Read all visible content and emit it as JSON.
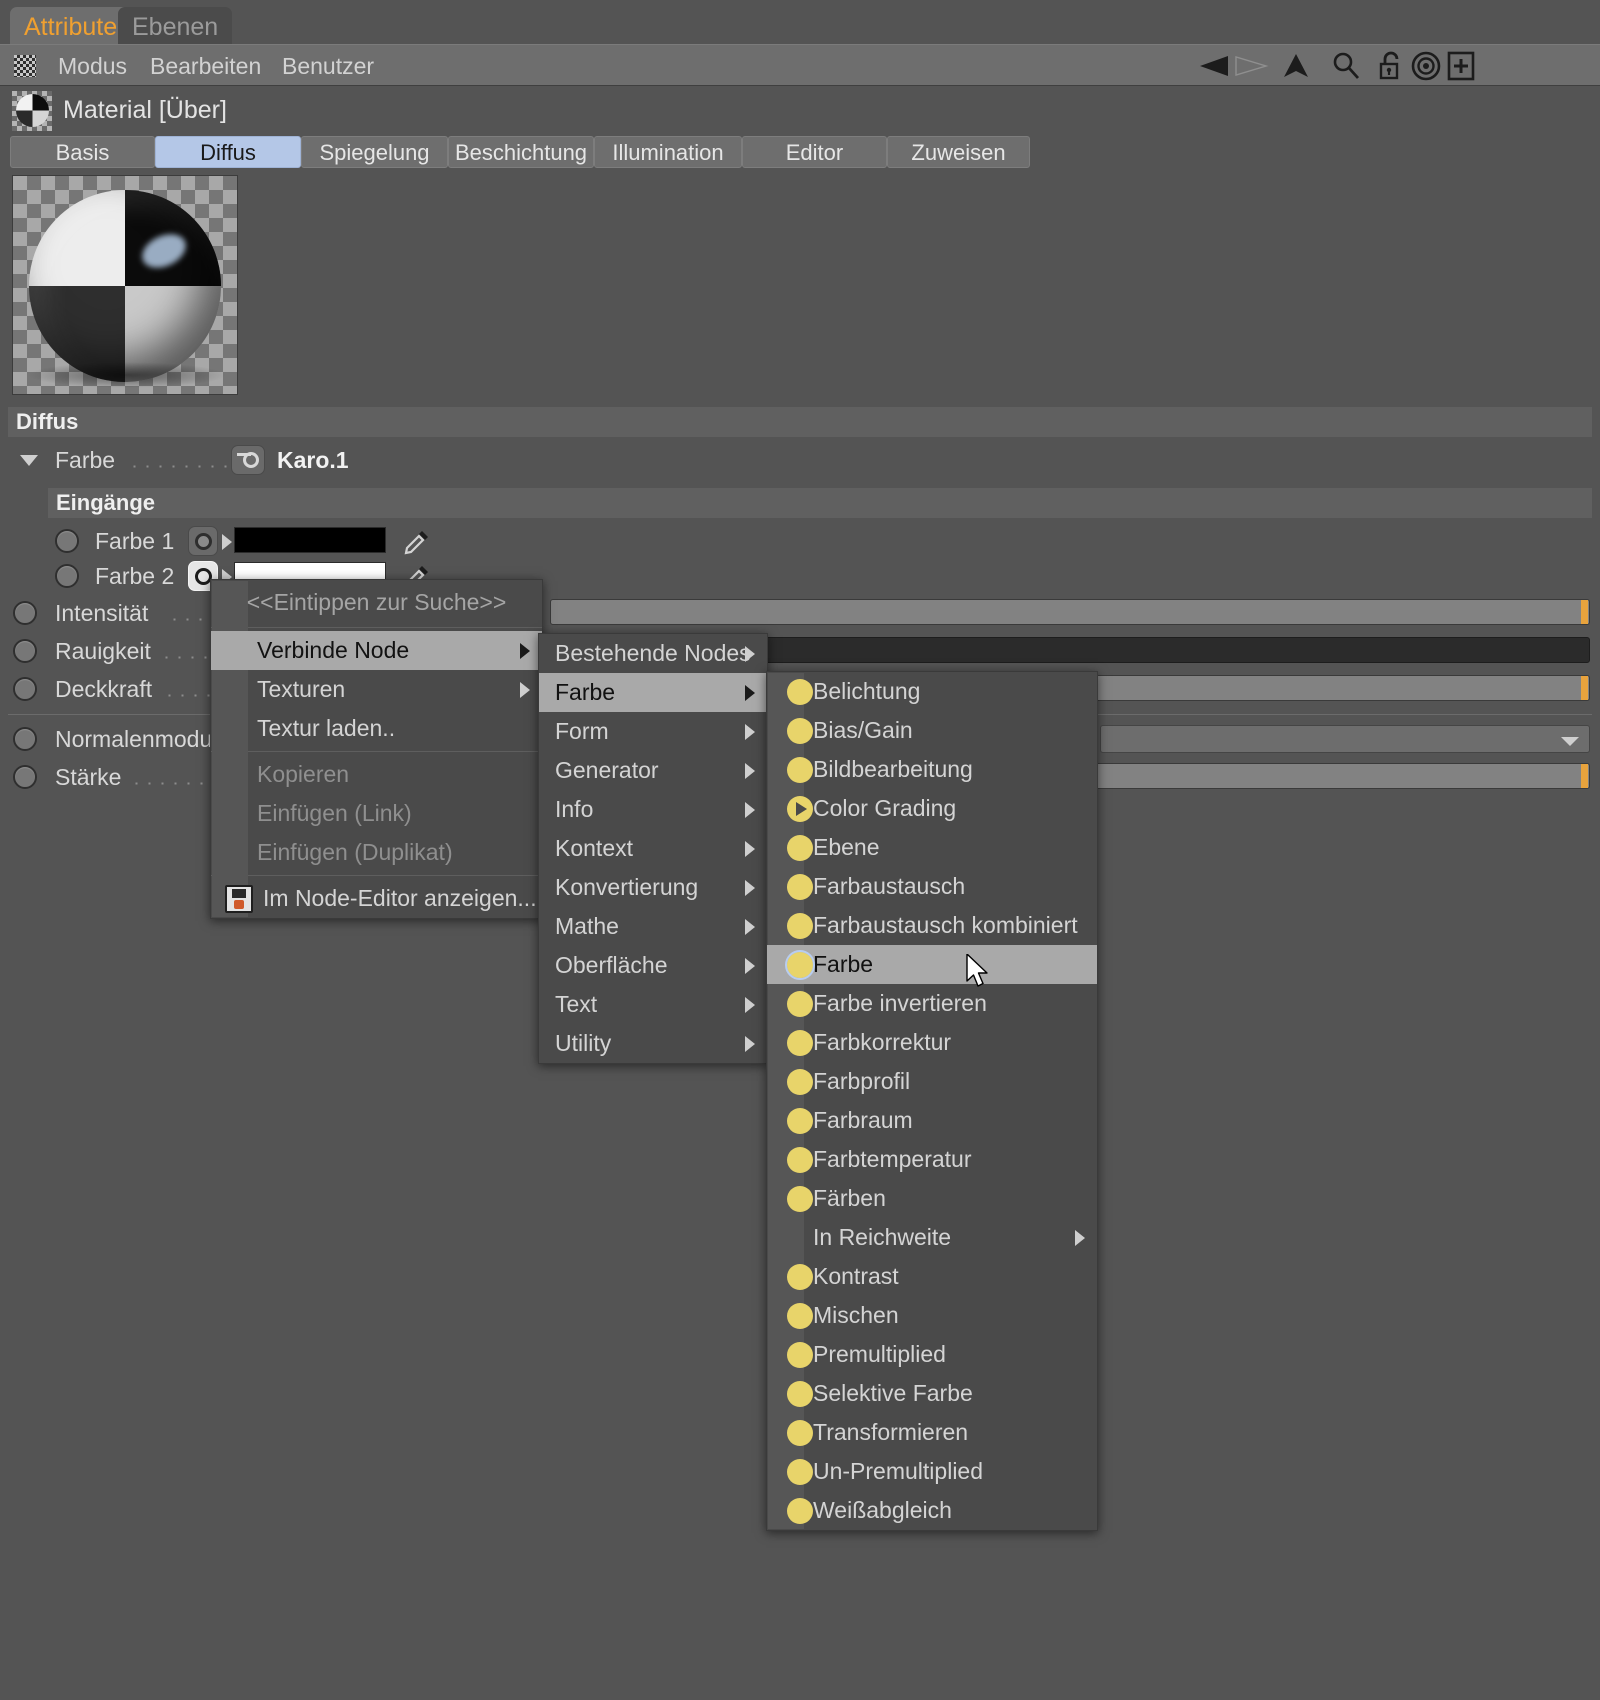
{
  "window": {
    "tabs": [
      {
        "label": "Attribute",
        "active": true
      },
      {
        "label": "Ebenen",
        "active": false
      }
    ],
    "menubar": [
      "Modus",
      "Bearbeiten",
      "Benutzer"
    ],
    "toolbar_icons": [
      "back-arrow-icon",
      "forward-arrow-icon",
      "up-arrow-icon",
      "search-icon",
      "unlock-icon",
      "target-icon",
      "add-panel-icon"
    ]
  },
  "material": {
    "title": "Material [Über]",
    "section_tabs": [
      {
        "label": "Basis",
        "selected": false
      },
      {
        "label": "Diffus",
        "selected": true
      },
      {
        "label": "Spiegelung",
        "selected": false
      },
      {
        "label": "Beschichtung",
        "selected": false
      },
      {
        "label": "Illumination",
        "selected": false
      },
      {
        "label": "Editor",
        "selected": false
      },
      {
        "label": "Zuweisen",
        "selected": false
      }
    ]
  },
  "diffus": {
    "group_title": "Diffus",
    "farbe_label": "Farbe",
    "farbe_value": "Karo.1",
    "inputs_header": "Eingänge",
    "inputs": [
      {
        "label": "Farbe 1",
        "swatch": "#000000"
      },
      {
        "label": "Farbe 2",
        "swatch": "#ffffff"
      }
    ],
    "params": [
      {
        "label": "Intensität",
        "type": "slider"
      },
      {
        "label": "Rauigkeit",
        "type": "numfield"
      },
      {
        "label": "Deckkraft",
        "type": "slider"
      },
      {
        "label": "Normalenmodus",
        "type": "dropdown"
      },
      {
        "label": "Stärke",
        "type": "slider"
      }
    ]
  },
  "context_menu": {
    "search_placeholder": "<<Eintippen zur Suche>>",
    "items": [
      {
        "label": "Verbinde Node",
        "submenu": true,
        "selected": true,
        "disabled": false
      },
      {
        "label": "Texturen",
        "submenu": true,
        "selected": false,
        "disabled": false
      },
      {
        "label": "Textur laden..",
        "submenu": false,
        "selected": false,
        "disabled": false
      },
      {
        "label": "Kopieren",
        "submenu": false,
        "selected": false,
        "disabled": true
      },
      {
        "label": "Einfügen (Link)",
        "submenu": false,
        "selected": false,
        "disabled": true
      },
      {
        "label": "Einfügen (Duplikat)",
        "submenu": false,
        "selected": false,
        "disabled": true
      },
      {
        "label": "Im Node-Editor anzeigen...",
        "submenu": false,
        "selected": false,
        "disabled": false,
        "icon": "save-icon"
      }
    ]
  },
  "submenu_categories": {
    "items": [
      {
        "label": "Bestehende Nodes",
        "submenu": true,
        "selected": false
      },
      {
        "label": "Farbe",
        "submenu": true,
        "selected": true
      },
      {
        "label": "Form",
        "submenu": true,
        "selected": false
      },
      {
        "label": "Generator",
        "submenu": true,
        "selected": false
      },
      {
        "label": "Info",
        "submenu": true,
        "selected": false
      },
      {
        "label": "Kontext",
        "submenu": true,
        "selected": false
      },
      {
        "label": "Konvertierung",
        "submenu": true,
        "selected": false
      },
      {
        "label": "Mathe",
        "submenu": true,
        "selected": false
      },
      {
        "label": "Oberfläche",
        "submenu": true,
        "selected": false
      },
      {
        "label": "Text",
        "submenu": true,
        "selected": false
      },
      {
        "label": "Utility",
        "submenu": true,
        "selected": false
      }
    ]
  },
  "submenu_farbe": {
    "items": [
      {
        "label": "Belichtung",
        "icon": "yellow-dot-icon",
        "selected": false,
        "submenu": false
      },
      {
        "label": "Bias/Gain",
        "icon": "yellow-dot-icon",
        "selected": false,
        "submenu": false
      },
      {
        "label": "Bildbearbeitung",
        "icon": "yellow-dot-icon",
        "selected": false,
        "submenu": false
      },
      {
        "label": "Color Grading",
        "icon": "yellow-play-icon",
        "selected": false,
        "submenu": false
      },
      {
        "label": "Ebene",
        "icon": "yellow-dot-icon",
        "selected": false,
        "submenu": false
      },
      {
        "label": "Farbaustausch",
        "icon": "yellow-dot-icon",
        "selected": false,
        "submenu": false
      },
      {
        "label": "Farbaustausch kombiniert",
        "icon": "yellow-dot-icon",
        "selected": false,
        "submenu": false
      },
      {
        "label": "Farbe",
        "icon": "yellow-dot-icon",
        "selected": true,
        "submenu": false
      },
      {
        "label": "Farbe invertieren",
        "icon": "yellow-dot-icon",
        "selected": false,
        "submenu": false
      },
      {
        "label": "Farbkorrektur",
        "icon": "yellow-dot-icon",
        "selected": false,
        "submenu": false
      },
      {
        "label": "Farbprofil",
        "icon": "yellow-dot-icon",
        "selected": false,
        "submenu": false
      },
      {
        "label": "Farbraum",
        "icon": "yellow-dot-icon",
        "selected": false,
        "submenu": false
      },
      {
        "label": "Farbtemperatur",
        "icon": "yellow-dot-icon",
        "selected": false,
        "submenu": false
      },
      {
        "label": "Färben",
        "icon": "yellow-dot-icon",
        "selected": false,
        "submenu": false
      },
      {
        "label": "In Reichweite",
        "icon": "none",
        "selected": false,
        "submenu": true
      },
      {
        "label": "Kontrast",
        "icon": "yellow-dot-icon",
        "selected": false,
        "submenu": false
      },
      {
        "label": "Mischen",
        "icon": "yellow-dot-icon",
        "selected": false,
        "submenu": false
      },
      {
        "label": "Premultiplied",
        "icon": "yellow-dot-icon",
        "selected": false,
        "submenu": false
      },
      {
        "label": "Selektive Farbe",
        "icon": "yellow-dot-icon",
        "selected": false,
        "submenu": false
      },
      {
        "label": "Transformieren",
        "icon": "yellow-dot-icon",
        "selected": false,
        "submenu": false
      },
      {
        "label": "Un-Premultiplied",
        "icon": "yellow-dot-icon",
        "selected": false,
        "submenu": false
      },
      {
        "label": "Weißabgleich",
        "icon": "yellow-dot-icon",
        "selected": false,
        "submenu": false
      }
    ]
  },
  "colors": {
    "accent": "#f0a030",
    "selected_tab": "#b4c7e7",
    "menu_highlight": "#a9a9a9",
    "node_dot": "#e8d46a",
    "slider_marker": "#e8a33d"
  }
}
